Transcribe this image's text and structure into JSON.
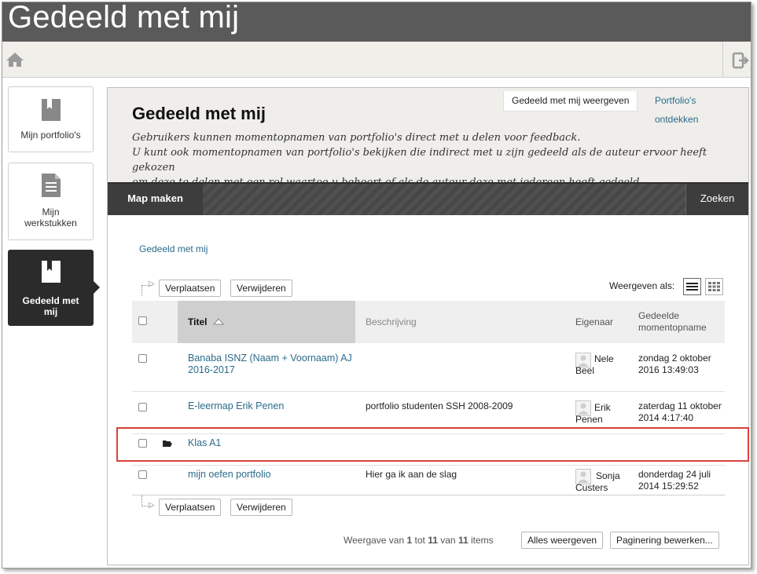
{
  "app": {
    "title": "Gedeeld met mij"
  },
  "sidebar": {
    "items": [
      {
        "label": "Mijn portfolio's",
        "icon": "bookmark-book-icon"
      },
      {
        "label": "Mijn werkstukken",
        "icon": "document-icon"
      },
      {
        "label": "Gedeeld met mij",
        "icon": "bookmark-book-icon",
        "active": true
      }
    ]
  },
  "header": {
    "heading": "Gedeeld met mij",
    "description": [
      "Gebruikers kunnen momentopnamen van portfolio's direct met u delen voor feedback.",
      "U kunt ook momentopnamen van portfolio's bekijken die indirect met u zijn gedeeld als de auteur ervoor heeft gekozen",
      "om deze te delen met een rol waartoe u behoort of als de auteur deze met iedereen heeft gedeeld."
    ],
    "tabs": [
      {
        "label": "Gedeeld met mij weergeven",
        "active": true
      },
      {
        "label": "Portfolio's ontdekken",
        "active": false
      }
    ]
  },
  "action_bar": {
    "create_folder": "Map maken",
    "search": "Zoeken"
  },
  "breadcrumb": "Gedeeld met mij",
  "toolbar": {
    "move": "Verplaatsen",
    "delete": "Verwijderen",
    "view_as": "Weergeven als:"
  },
  "table": {
    "columns": [
      "Titel",
      "Beschrijving",
      "Eigenaar",
      "Gedeelde momentopname"
    ],
    "rows": [
      {
        "title": "Banaba ISNZ (Naam + Voornaam) AJ 2016-2017",
        "description": "",
        "owner": "Nele Beel",
        "date": "zondag 2 oktober 2016 13:49:03"
      },
      {
        "title": "E-leermap Erik Penen",
        "description": "portfolio studenten SSH 2008-2009",
        "owner": "Erik Penen",
        "date": "zaterdag 11 oktober 2014 4:17:40"
      },
      {
        "title": "Klas A1",
        "description": "",
        "owner": "",
        "date": "",
        "is_folder": true
      },
      {
        "title": "mijn oefen portfolio",
        "description": "Hier ga ik aan de slag",
        "owner": "Sonja Custers",
        "date": "donderdag 24 juli 2014 15:29:52"
      }
    ]
  },
  "pagination": {
    "prefix": "Weergave van",
    "from": "1",
    "to_word": "tot",
    "to": "11",
    "of_word": "van",
    "total": "11",
    "suffix": "items",
    "show_all": "Alles weergeven",
    "edit_paging": "Paginering bewerken..."
  },
  "colors": {
    "accent_link": "#2b6b8a",
    "highlight": "#d9413a",
    "titlebar": "#5a5a5a"
  }
}
